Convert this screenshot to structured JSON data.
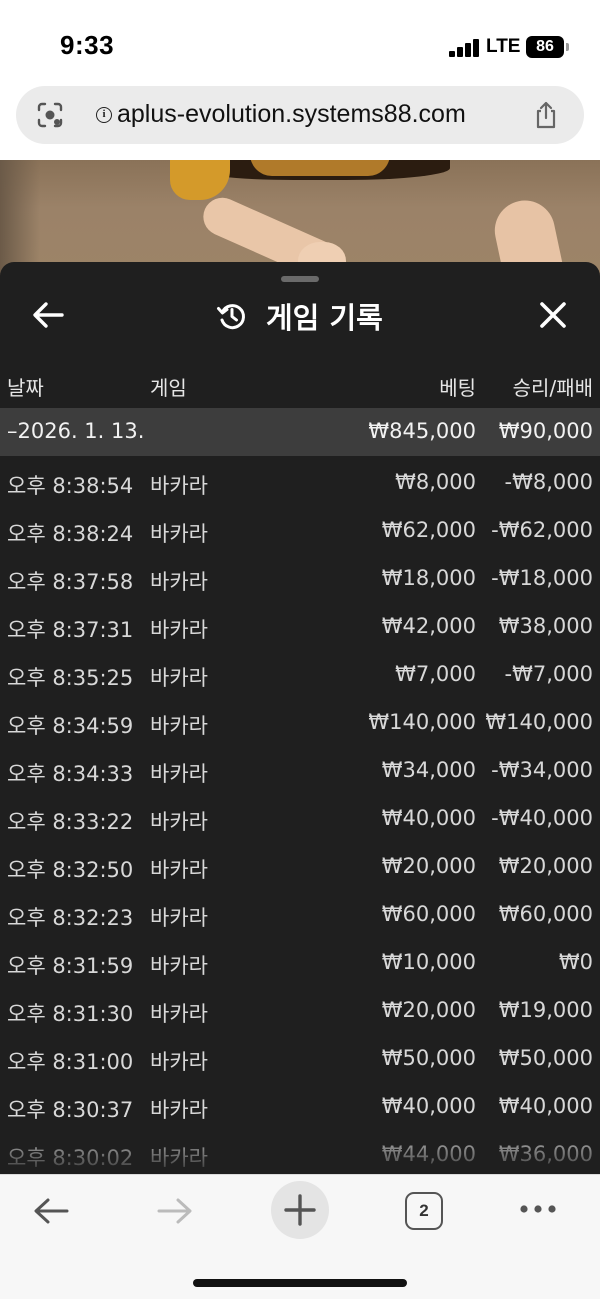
{
  "status_bar": {
    "time": "9:33",
    "network": "LTE",
    "battery": "86"
  },
  "browser": {
    "url": "aplus-evolution.systems88.com",
    "tab_count": "2"
  },
  "panel": {
    "title": "게임 기록",
    "columns": {
      "date": "날짜",
      "game": "게임",
      "bet": "베팅",
      "result": "승리/패배"
    },
    "summary": {
      "date": "–2026. 1. 13.",
      "bet": "₩845,000",
      "result": "₩90,000"
    },
    "rows": [
      {
        "time": "오후 8:38:54",
        "game": "바카라",
        "bet": "₩8,000",
        "result": "-₩8,000"
      },
      {
        "time": "오후 8:38:24",
        "game": "바카라",
        "bet": "₩62,000",
        "result": "-₩62,000"
      },
      {
        "time": "오후 8:37:58",
        "game": "바카라",
        "bet": "₩18,000",
        "result": "-₩18,000"
      },
      {
        "time": "오후 8:37:31",
        "game": "바카라",
        "bet": "₩42,000",
        "result": "₩38,000"
      },
      {
        "time": "오후 8:35:25",
        "game": "바카라",
        "bet": "₩7,000",
        "result": "-₩7,000"
      },
      {
        "time": "오후 8:34:59",
        "game": "바카라",
        "bet": "₩140,000",
        "result": "₩140,000"
      },
      {
        "time": "오후 8:34:33",
        "game": "바카라",
        "bet": "₩34,000",
        "result": "-₩34,000"
      },
      {
        "time": "오후 8:33:22",
        "game": "바카라",
        "bet": "₩40,000",
        "result": "-₩40,000"
      },
      {
        "time": "오후 8:32:50",
        "game": "바카라",
        "bet": "₩20,000",
        "result": "₩20,000"
      },
      {
        "time": "오후 8:32:23",
        "game": "바카라",
        "bet": "₩60,000",
        "result": "₩60,000"
      },
      {
        "time": "오후 8:31:59",
        "game": "바카라",
        "bet": "₩10,000",
        "result": "₩0"
      },
      {
        "time": "오후 8:31:30",
        "game": "바카라",
        "bet": "₩20,000",
        "result": "₩19,000"
      },
      {
        "time": "오후 8:31:00",
        "game": "바카라",
        "bet": "₩50,000",
        "result": "₩50,000"
      },
      {
        "time": "오후 8:30:37",
        "game": "바카라",
        "bet": "₩40,000",
        "result": "₩40,000"
      },
      {
        "time": "오후 8:30:02",
        "game": "바카라",
        "bet": "₩44,000",
        "result": "₩36,000"
      }
    ]
  },
  "icons": {
    "status": [
      "signal-icon"
    ],
    "url_bar": [
      "lens-icon",
      "info-icon",
      "share-icon"
    ],
    "panel": [
      "back-arrow-icon",
      "history-icon",
      "close-icon"
    ],
    "toolbar": [
      "back-arrow-icon",
      "forward-arrow-icon",
      "plus-icon",
      "tabs-icon",
      "more-icon"
    ]
  },
  "colors": {
    "panel_bg": "#1f1f1f",
    "summary_bg": "#3d3d3d",
    "text": "#d8d8d8"
  }
}
